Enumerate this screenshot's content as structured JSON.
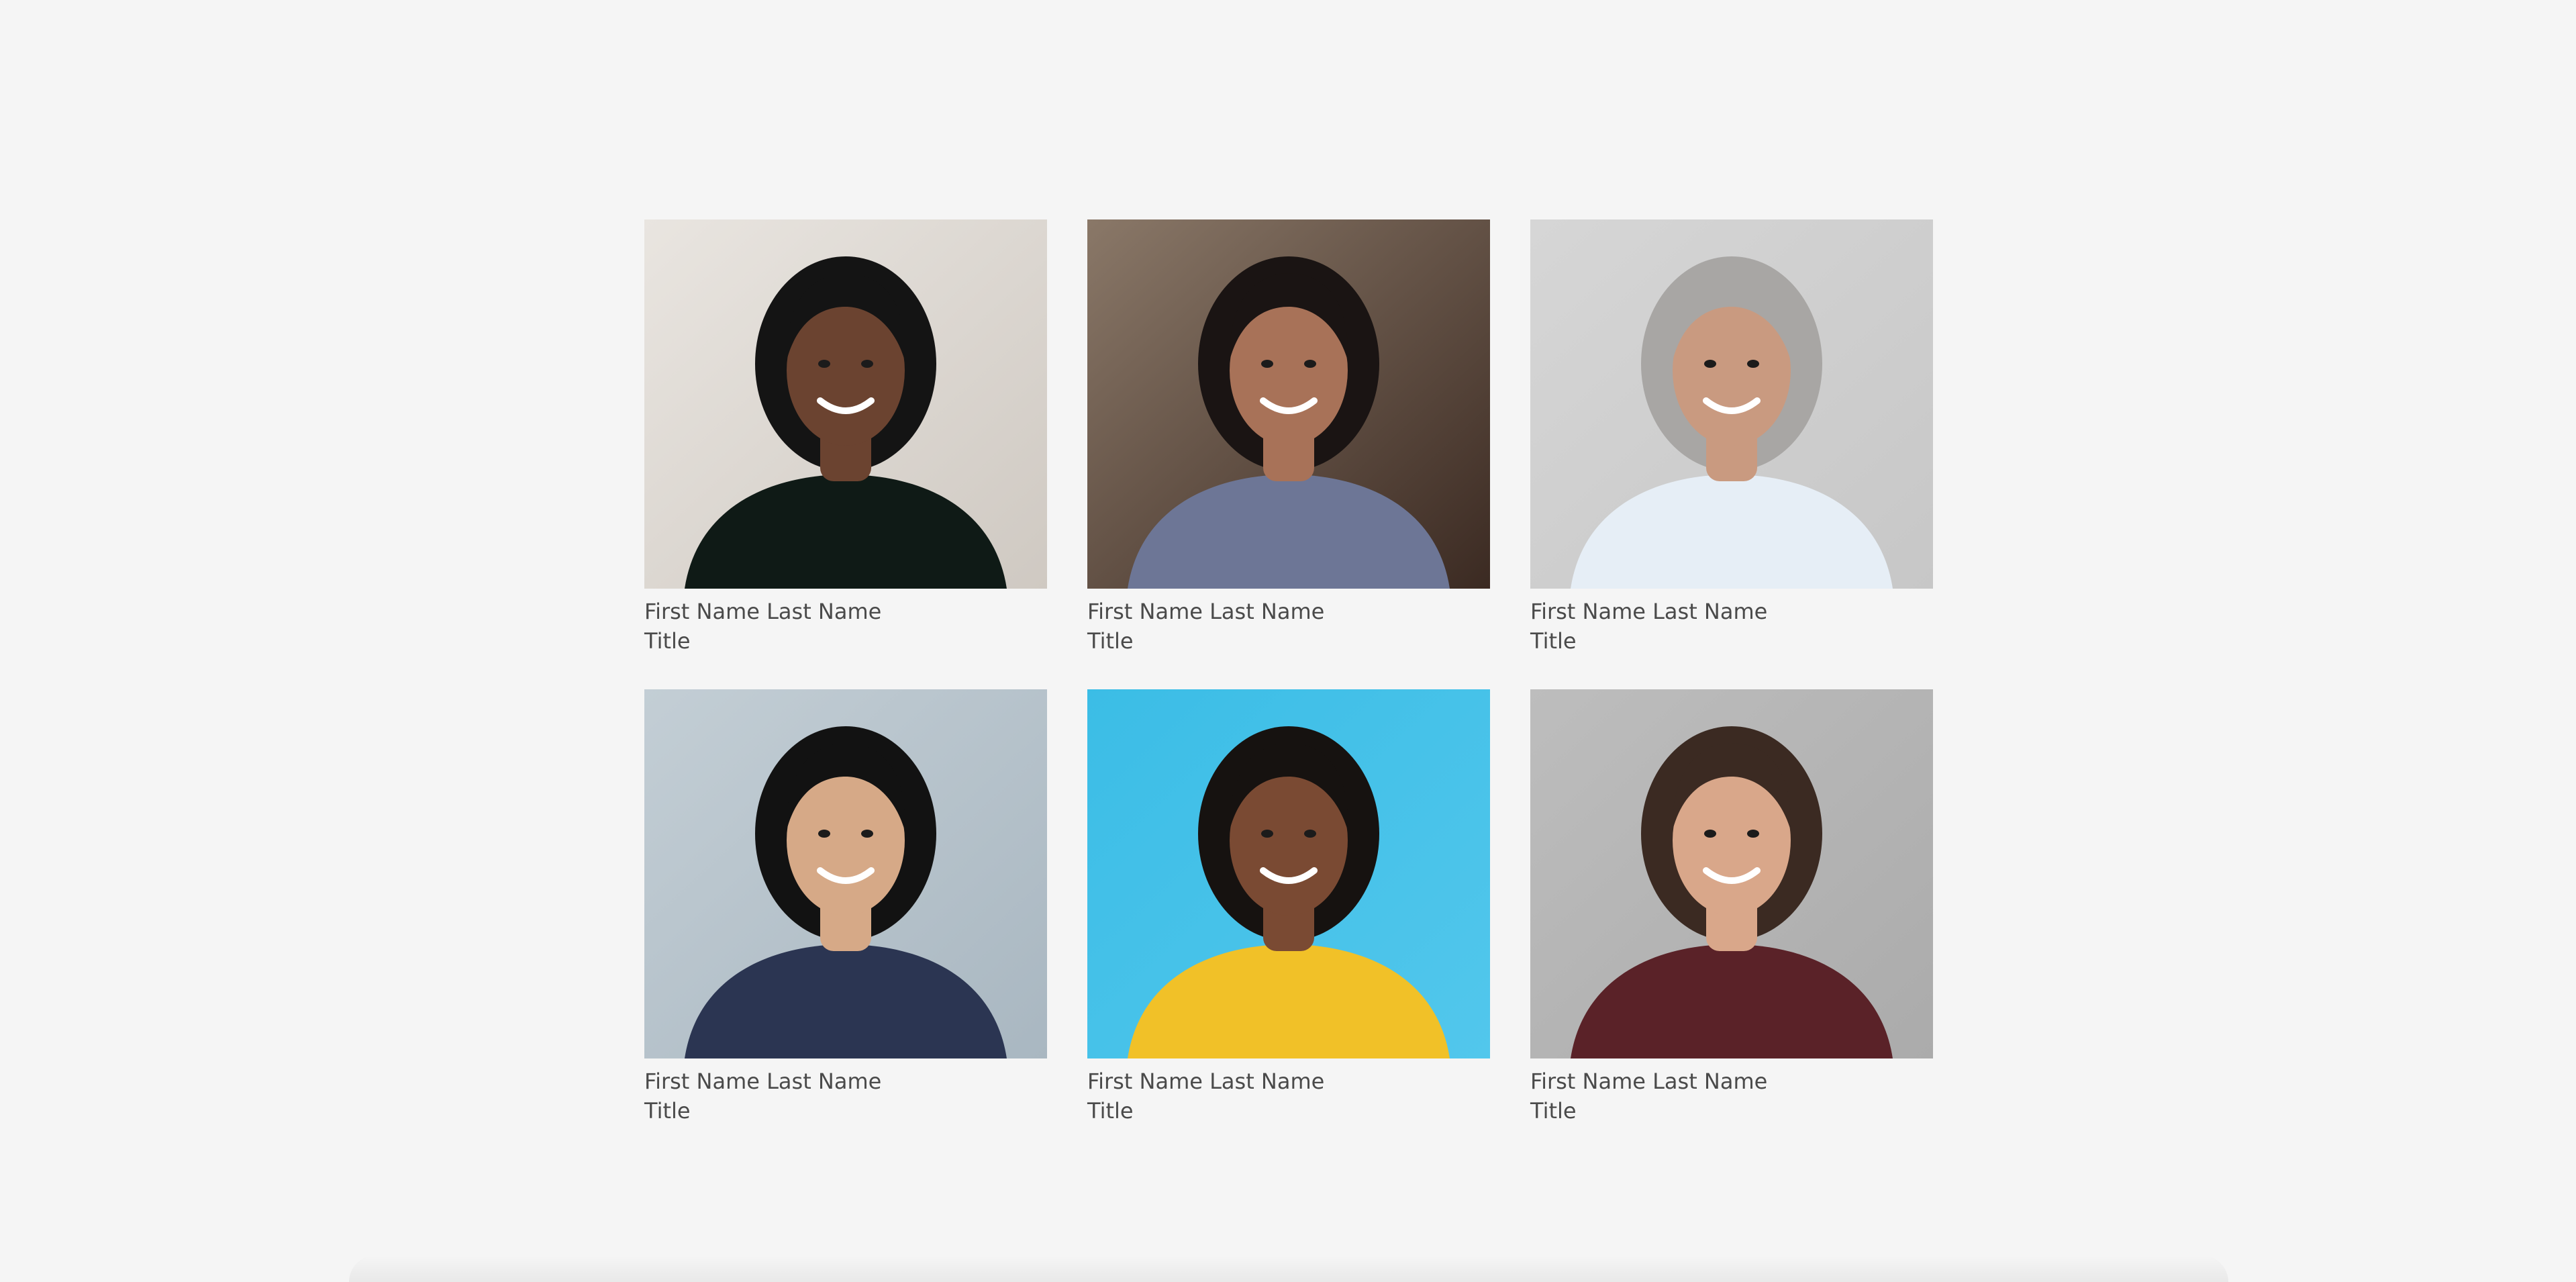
{
  "team": {
    "members": [
      {
        "name": "First Name Last Name",
        "title": "Title",
        "colors": {
          "bg": "#cfc9c2",
          "bg2": "#e9e5e0",
          "skin": "#6b4330",
          "hair": "#141414",
          "shirt": "#0f1a16"
        }
      },
      {
        "name": "First Name Last Name",
        "title": "Title",
        "colors": {
          "bg": "#3b2a22",
          "bg2": "#8a7868",
          "skin": "#a87258",
          "hair": "#1a1413",
          "shirt": "#6d7696"
        }
      },
      {
        "name": "First Name Last Name",
        "title": "Title",
        "colors": {
          "bg": "#c7c7c7",
          "bg2": "#d6d6d6",
          "skin": "#c99a80",
          "hair": "#a8a6a4",
          "shirt": "#e6eef6"
        }
      },
      {
        "name": "First Name Last Name",
        "title": "Title",
        "colors": {
          "bg": "#a9b7c1",
          "bg2": "#c3ced5",
          "skin": "#d6a987",
          "hair": "#121212",
          "shirt": "#2b3552"
        }
      },
      {
        "name": "First Name Last Name",
        "title": "Title",
        "colors": {
          "bg": "#52c7ec",
          "bg2": "#3bbde6",
          "skin": "#7a4a33",
          "hair": "#161210",
          "shirt": "#f1c128"
        }
      },
      {
        "name": "First Name Last Name",
        "title": "Title",
        "colors": {
          "bg": "#ababab",
          "bg2": "#bdbdbd",
          "skin": "#d9a78a",
          "hair": "#3b2a22",
          "shirt": "#5a2228"
        }
      }
    ]
  }
}
